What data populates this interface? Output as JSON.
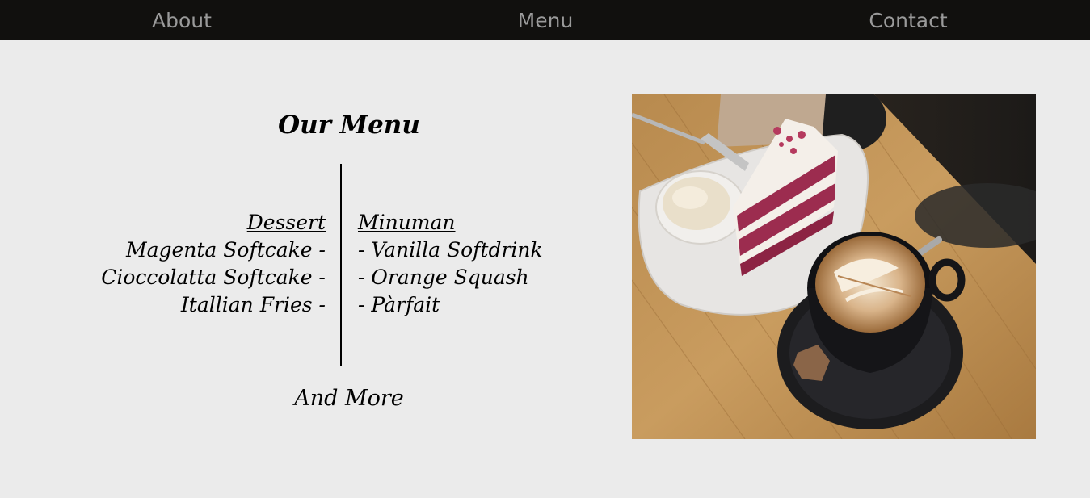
{
  "nav": {
    "about": "About",
    "menu": "Menu",
    "contact": "Contact"
  },
  "menu_section": {
    "title": "Our Menu",
    "dessert": {
      "heading": "Dessert",
      "items": [
        "Magenta Softcake -",
        "Cioccolatta Softcake -",
        "Itallian Fries -"
      ]
    },
    "drinks": {
      "heading": "Minuman",
      "items": [
        "- Vanilla Softdrink",
        "- Orange Squash",
        "- Pàrfait"
      ]
    },
    "footer": "And More"
  },
  "photo": {
    "subject": "red velvet cake slice with ice cream and latte on wooden table"
  },
  "colors": {
    "nav_background": "#11100e",
    "nav_text": "#9a9a9a",
    "page_background": "#ebebeb",
    "text": "#000000"
  }
}
